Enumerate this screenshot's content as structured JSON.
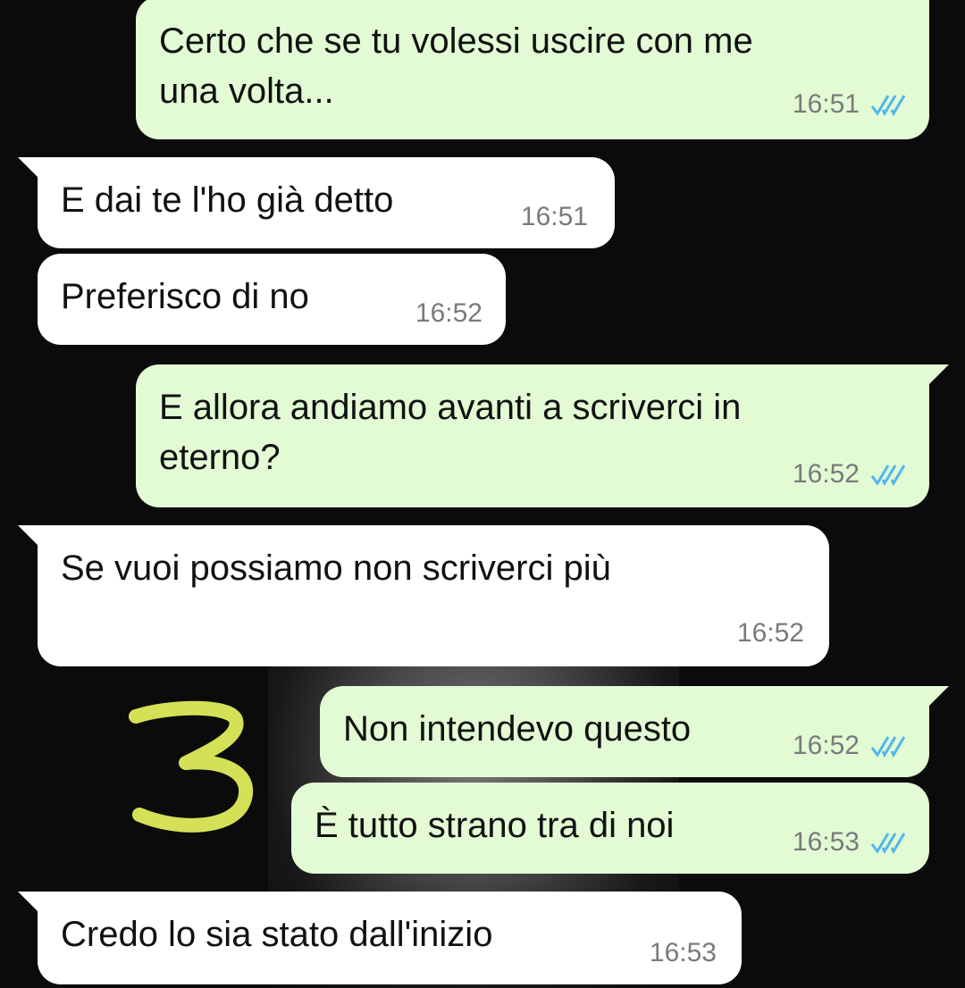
{
  "chat": {
    "messages": [
      {
        "text_line1": "Certo che se tu volessi uscire con me",
        "text_line2": "una volta...",
        "time": "16:51",
        "status": "read-double-check"
      },
      {
        "text": "E dai te l'ho già detto",
        "time": "16:51"
      },
      {
        "text": "Preferisco di no",
        "time": "16:52"
      },
      {
        "text_line1": "E allora andiamo avanti a scriverci in",
        "text_line2": "eterno?",
        "time": "16:52",
        "status": "read-double-check"
      },
      {
        "text": "Se vuoi possiamo non scriverci più",
        "time": "16:52"
      },
      {
        "text": "Non intendevo questo",
        "time": "16:52",
        "status": "read-double-check"
      },
      {
        "text": "È tutto strano tra di noi",
        "time": "16:53",
        "status": "read-double-check"
      },
      {
        "text": "Credo lo sia stato dall'inizio",
        "time": "16:53"
      }
    ]
  },
  "annotation": {
    "label": "3",
    "color": "#d4e157"
  },
  "colors": {
    "outgoing_bubble": "#e2fbd4",
    "incoming_bubble": "#ffffff",
    "read_ticks": "#4fb6ec",
    "background": "#0b0b0b",
    "timestamp": "#7a7a7a"
  }
}
